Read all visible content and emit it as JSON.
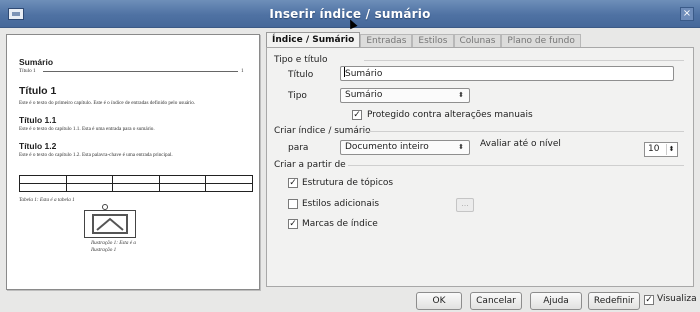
{
  "window": {
    "title": "Inserir índice / sumário"
  },
  "preview": {
    "toc_heading": "Sumário",
    "toc_entry": "Título 1",
    "toc_page": "1",
    "heading1": "Título 1",
    "heading1_text": "Este é o texto do primeiro capítulo. Este é o índice de entradas definido pelo usuário.",
    "heading11": "Título 1.1",
    "heading11_text": "Este é o texto do capítulo 1.1. Esta é uma entrada para o sumário.",
    "heading12": "Título 1.2",
    "heading12_text": "Este é o texto do capítulo 1.2. Esta palavra-chave é uma entrada principal.",
    "table_caption": "Tabela 1: Esta é a tabela 1",
    "image_caption_line1": "Ilustração 1: Esta é a",
    "image_caption_line2": "Ilustração 1"
  },
  "tabs": [
    {
      "label": "Índice / Sumário",
      "active": true
    },
    {
      "label": "Entradas",
      "active": false
    },
    {
      "label": "Estilos",
      "active": false
    },
    {
      "label": "Colunas",
      "active": false
    },
    {
      "label": "Plano de fundo",
      "active": false
    }
  ],
  "type_section": {
    "heading": "Tipo e título",
    "title_label": "Título",
    "title_value": "Sumário",
    "type_label": "Tipo",
    "type_value": "Sumário",
    "protect_label": "Protegido contra alterações manuais",
    "protect_checked": true
  },
  "create_section": {
    "heading": "Criar índice / sumário",
    "for_label": "para",
    "for_value": "Documento inteiro",
    "level_label": "Avaliar até o nível",
    "level_value": "10"
  },
  "from_section": {
    "heading": "Criar a partir de",
    "outline_label": "Estrutura de tópicos",
    "outline_checked": true,
    "styles_label": "Estilos adicionais",
    "styles_checked": false,
    "styles_button": "...",
    "marks_label": "Marcas de índice",
    "marks_checked": true
  },
  "buttons": {
    "ok": "OK",
    "cancel": "Cancelar",
    "help": "Ajuda",
    "reset": "Redefinir",
    "preview_label": "Visualiza",
    "preview_checked": true
  }
}
